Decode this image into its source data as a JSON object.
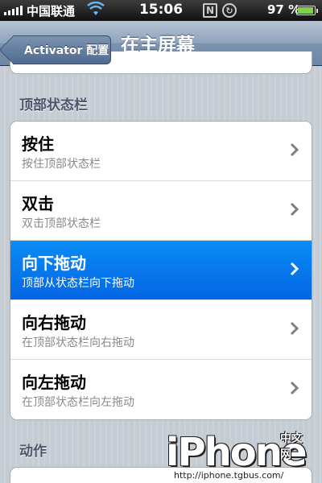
{
  "status_bar": {
    "carrier": "中国联通",
    "time": "15:06",
    "battery": "97 %"
  },
  "nav": {
    "back_label": "Activator 配置",
    "title": "在主屏幕"
  },
  "sections": [
    {
      "header": "顶部状态栏",
      "rows": [
        {
          "title": "按住",
          "subtitle": "按住顶部状态栏"
        },
        {
          "title": "双击",
          "subtitle": "双击顶部状态栏"
        },
        {
          "title": "向下拖动",
          "subtitle": "顶部从状态栏向下拖动",
          "selected": true
        },
        {
          "title": "向右拖动",
          "subtitle": "在顶部状态栏向右拖动"
        },
        {
          "title": "向左拖动",
          "subtitle": "在顶部状态栏向左拖动"
        }
      ]
    },
    {
      "header": "动作"
    }
  ],
  "watermark": {
    "brand": "iPhone",
    "cn": "中文网",
    "url": "http://iphone.tgbus.com/"
  },
  "colors": {
    "selected_row": "#0566e4",
    "nav_bar": "#6d86a5",
    "section_header": "#4c566c"
  }
}
